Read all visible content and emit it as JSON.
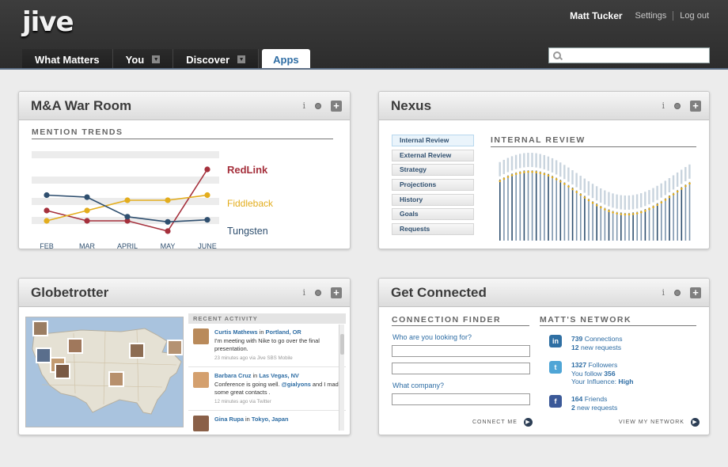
{
  "app": {
    "logo": "jive",
    "user_name": "Matt Tucker",
    "settings_link": "Settings",
    "logout_link": "Log out"
  },
  "tabs": [
    {
      "label": "What Matters"
    },
    {
      "label": "You"
    },
    {
      "label": "Discover"
    },
    {
      "label": "Apps"
    }
  ],
  "search": {
    "value": "",
    "placeholder": ""
  },
  "ma_widget": {
    "title": "M&A War Room",
    "section": "MENTION TRENDS",
    "months": [
      "FEB",
      "MAR",
      "APRIL",
      "MAY",
      "JUNE"
    ],
    "series": [
      {
        "name": "RedLink",
        "color": "#a5303c",
        "values": [
          2,
          1,
          1,
          0,
          6
        ]
      },
      {
        "name": "Fiddleback",
        "color": "#e3ad1d",
        "values": [
          1,
          2,
          3,
          3,
          3.5
        ]
      },
      {
        "name": "Tungsten",
        "color": "#2f4f6f",
        "values": [
          3.5,
          3.3,
          1.4,
          0.9,
          1.1
        ]
      }
    ]
  },
  "nexus_widget": {
    "title": "Nexus",
    "menu": [
      "Internal Review",
      "External Review",
      "Strategy",
      "Projections",
      "History",
      "Goals",
      "Requests"
    ],
    "section": "INTERNAL REVIEW"
  },
  "globe_widget": {
    "title": "Globetrotter",
    "section": "RECENT ACTIVITY",
    "items": [
      {
        "name": "Curtis Mathews",
        "in": "in",
        "location": "Portland, OR",
        "text": "I'm meeting with Nike to go over the final presentation.",
        "meta_prefix": "23 minutes ago via",
        "meta_source": "Jive SBS Mobile",
        "color": "#b98a5a"
      },
      {
        "name": "Barbara Cruz",
        "in": "in",
        "location": "Las Vegas, NV",
        "text_a": "Conference is going well.",
        "mention": "@gialyons",
        "text_b": "and I made some great contacts .",
        "meta_prefix": "12 minutes ago via",
        "meta_source": "Twitter",
        "color": "#d4a06e"
      },
      {
        "name": "Gina Rupa",
        "in": "in",
        "location": "Tokyo, Japan",
        "color": "#8a6048"
      }
    ]
  },
  "connect_widget": {
    "title": "Get Connected",
    "finder_title": "CONNECTION FINDER",
    "q1": "Who are you looking for?",
    "q2": "What company?",
    "connect_btn": "CONNECT ME",
    "network_title": "MATT'S NETWORK",
    "linkedin": {
      "icon": "linkedin-icon",
      "l1_num": "739",
      "l1": "Connections",
      "l2_num": "12",
      "l2": "new requests"
    },
    "twitter": {
      "icon": "twitter-icon",
      "l1_num": "1327",
      "l1": "Followers",
      "l2_pre": "You follow",
      "l2_num": "356",
      "l3_pre": "Your Influence:",
      "l3_val": "High"
    },
    "facebook": {
      "icon": "facebook-icon",
      "l1_num": "164",
      "l1": "Friends",
      "l2_num": "2",
      "l2": "new requests"
    },
    "view_btn": "VIEW MY NETWORK"
  }
}
